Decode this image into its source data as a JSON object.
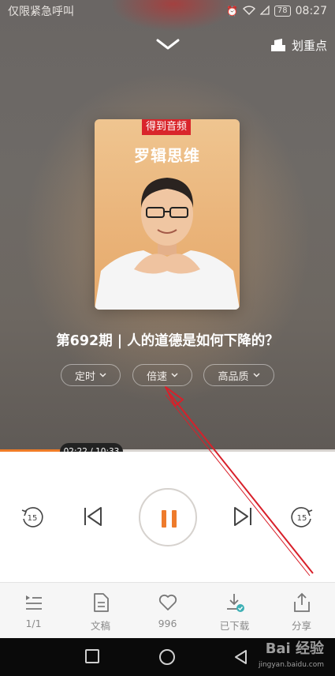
{
  "status_bar": {
    "carrier": "仅限紧急呼叫",
    "battery": "78",
    "time": "08:27"
  },
  "header": {
    "highlight_label": "划重点"
  },
  "cover": {
    "brand": "得到音频",
    "show_title": "罗辑思维"
  },
  "episode": {
    "title": "第692期 | 人的道德是如何下降的？"
  },
  "options": {
    "timer": "定时",
    "speed": "倍速",
    "quality": "高品质"
  },
  "progress": {
    "time_label": "02:22 / 10:33",
    "fraction": 0.22,
    "accent": "#f07c27"
  },
  "controls": {
    "rewind_seconds": "15",
    "forward_seconds": "15"
  },
  "bottom_nav": [
    {
      "label": "1/1",
      "icon": "playlist-icon"
    },
    {
      "label": "文稿",
      "icon": "document-icon"
    },
    {
      "label": "996",
      "icon": "heart-icon"
    },
    {
      "label": "已下载",
      "icon": "downloaded-icon"
    },
    {
      "label": "分享",
      "icon": "share-icon"
    }
  ],
  "watermark": {
    "brand": "Bai 经验",
    "url": "jingyan.baidu.com"
  }
}
